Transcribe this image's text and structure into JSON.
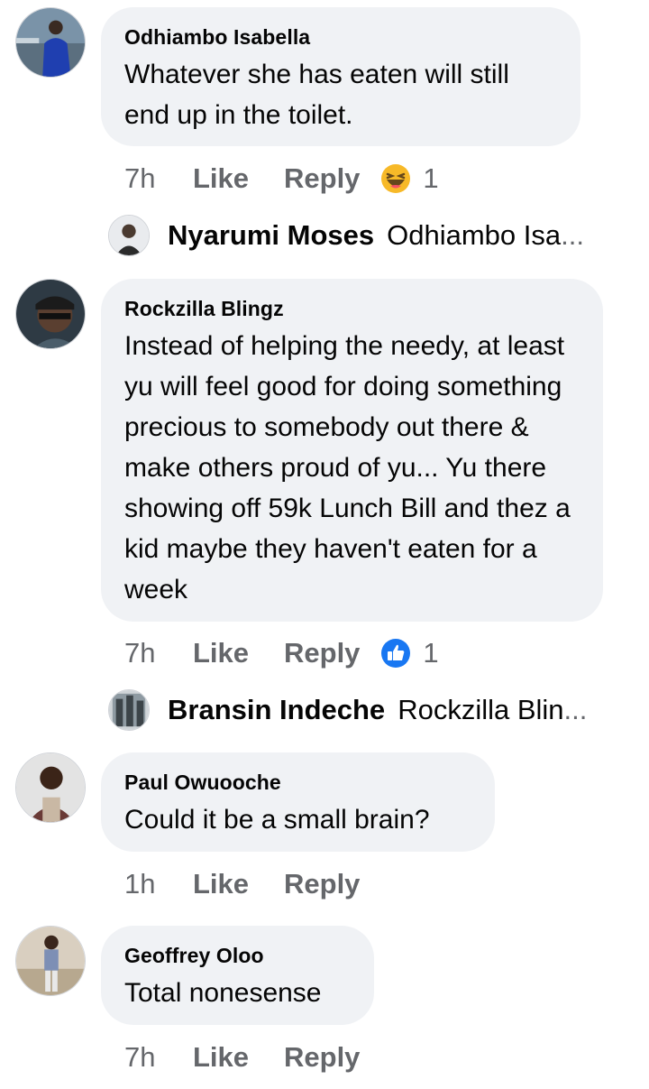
{
  "comments": [
    {
      "author": "Odhiambo Isabella",
      "text": "Whatever she has eaten will still end up in the toilet.",
      "time": "7h",
      "like_label": "Like",
      "reply_label": "Reply",
      "reaction": "haha-emoji-icon",
      "reaction_count": "1",
      "reply_preview": {
        "author": "Nyarumi Moses",
        "snippet": "Odhiambo Isa",
        "ellipsis": "..."
      }
    },
    {
      "author": "Rockzilla Blingz",
      "text": "Instead of helping the needy, at least yu will feel good for doing something precious to somebody out there & make others proud of yu... Yu there showing off 59k Lunch Bill and thez a kid maybe they haven't eaten for a week",
      "time": "7h",
      "like_label": "Like",
      "reply_label": "Reply",
      "reaction": "like-thumb-icon",
      "reaction_count": "1",
      "reply_preview": {
        "author": "Bransin Indeche",
        "snippet": "Rockzilla Blin",
        "ellipsis": "..."
      }
    },
    {
      "author": "Paul Owuooche",
      "text": "Could it be a small brain?",
      "time": "1h",
      "like_label": "Like",
      "reply_label": "Reply"
    },
    {
      "author": "Geoffrey Oloo",
      "text": "Total nonesense",
      "time": "7h",
      "like_label": "Like",
      "reply_label": "Reply"
    }
  ],
  "colors": {
    "bubble": "#f0f2f5",
    "meta_text": "#65676b",
    "like_blue": "#1877f2",
    "haha_yellow": "#f7b928"
  }
}
